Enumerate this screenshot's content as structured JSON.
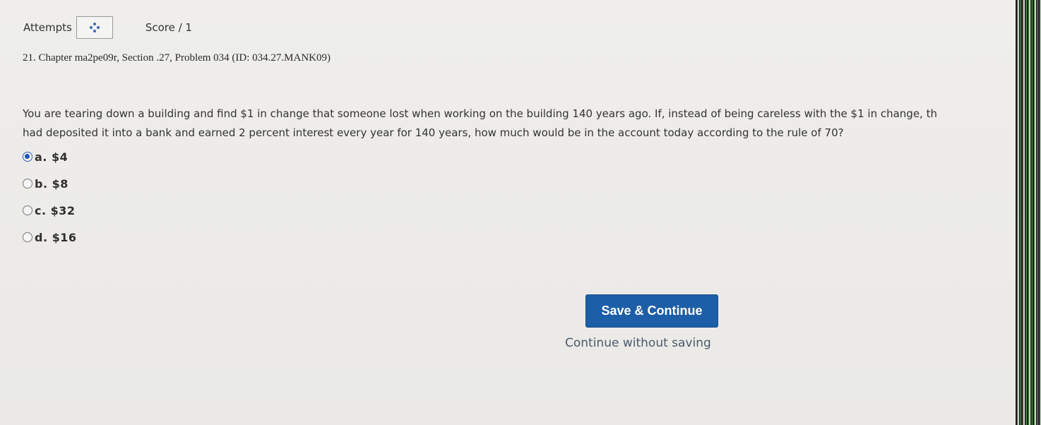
{
  "header": {
    "attempts_label": "Attempts",
    "score_label": "Score / 1"
  },
  "problem": {
    "title": "21. Chapter ma2pe09r, Section .27, Problem 034 (ID: 034.27.MANK09)",
    "question_line1": "You are tearing down a building and find $1 in change that someone lost when working on the building 140 years ago. If, instead of being careless with the $1 in change, th",
    "question_line2": "had deposited it into a bank and earned 2 percent interest every year for 140 years, how much would be in the account today according to the rule of 70?"
  },
  "options": [
    {
      "label": "a. $4",
      "selected": true
    },
    {
      "label": "b. $8",
      "selected": false
    },
    {
      "label": "c. $32",
      "selected": false
    },
    {
      "label": "d. $16",
      "selected": false
    }
  ],
  "actions": {
    "save_label": "Save & Continue",
    "continue_label": "Continue without saving"
  },
  "colors": {
    "primary_button": "#1d5ea8",
    "selected_radio": "#1f56b3"
  }
}
